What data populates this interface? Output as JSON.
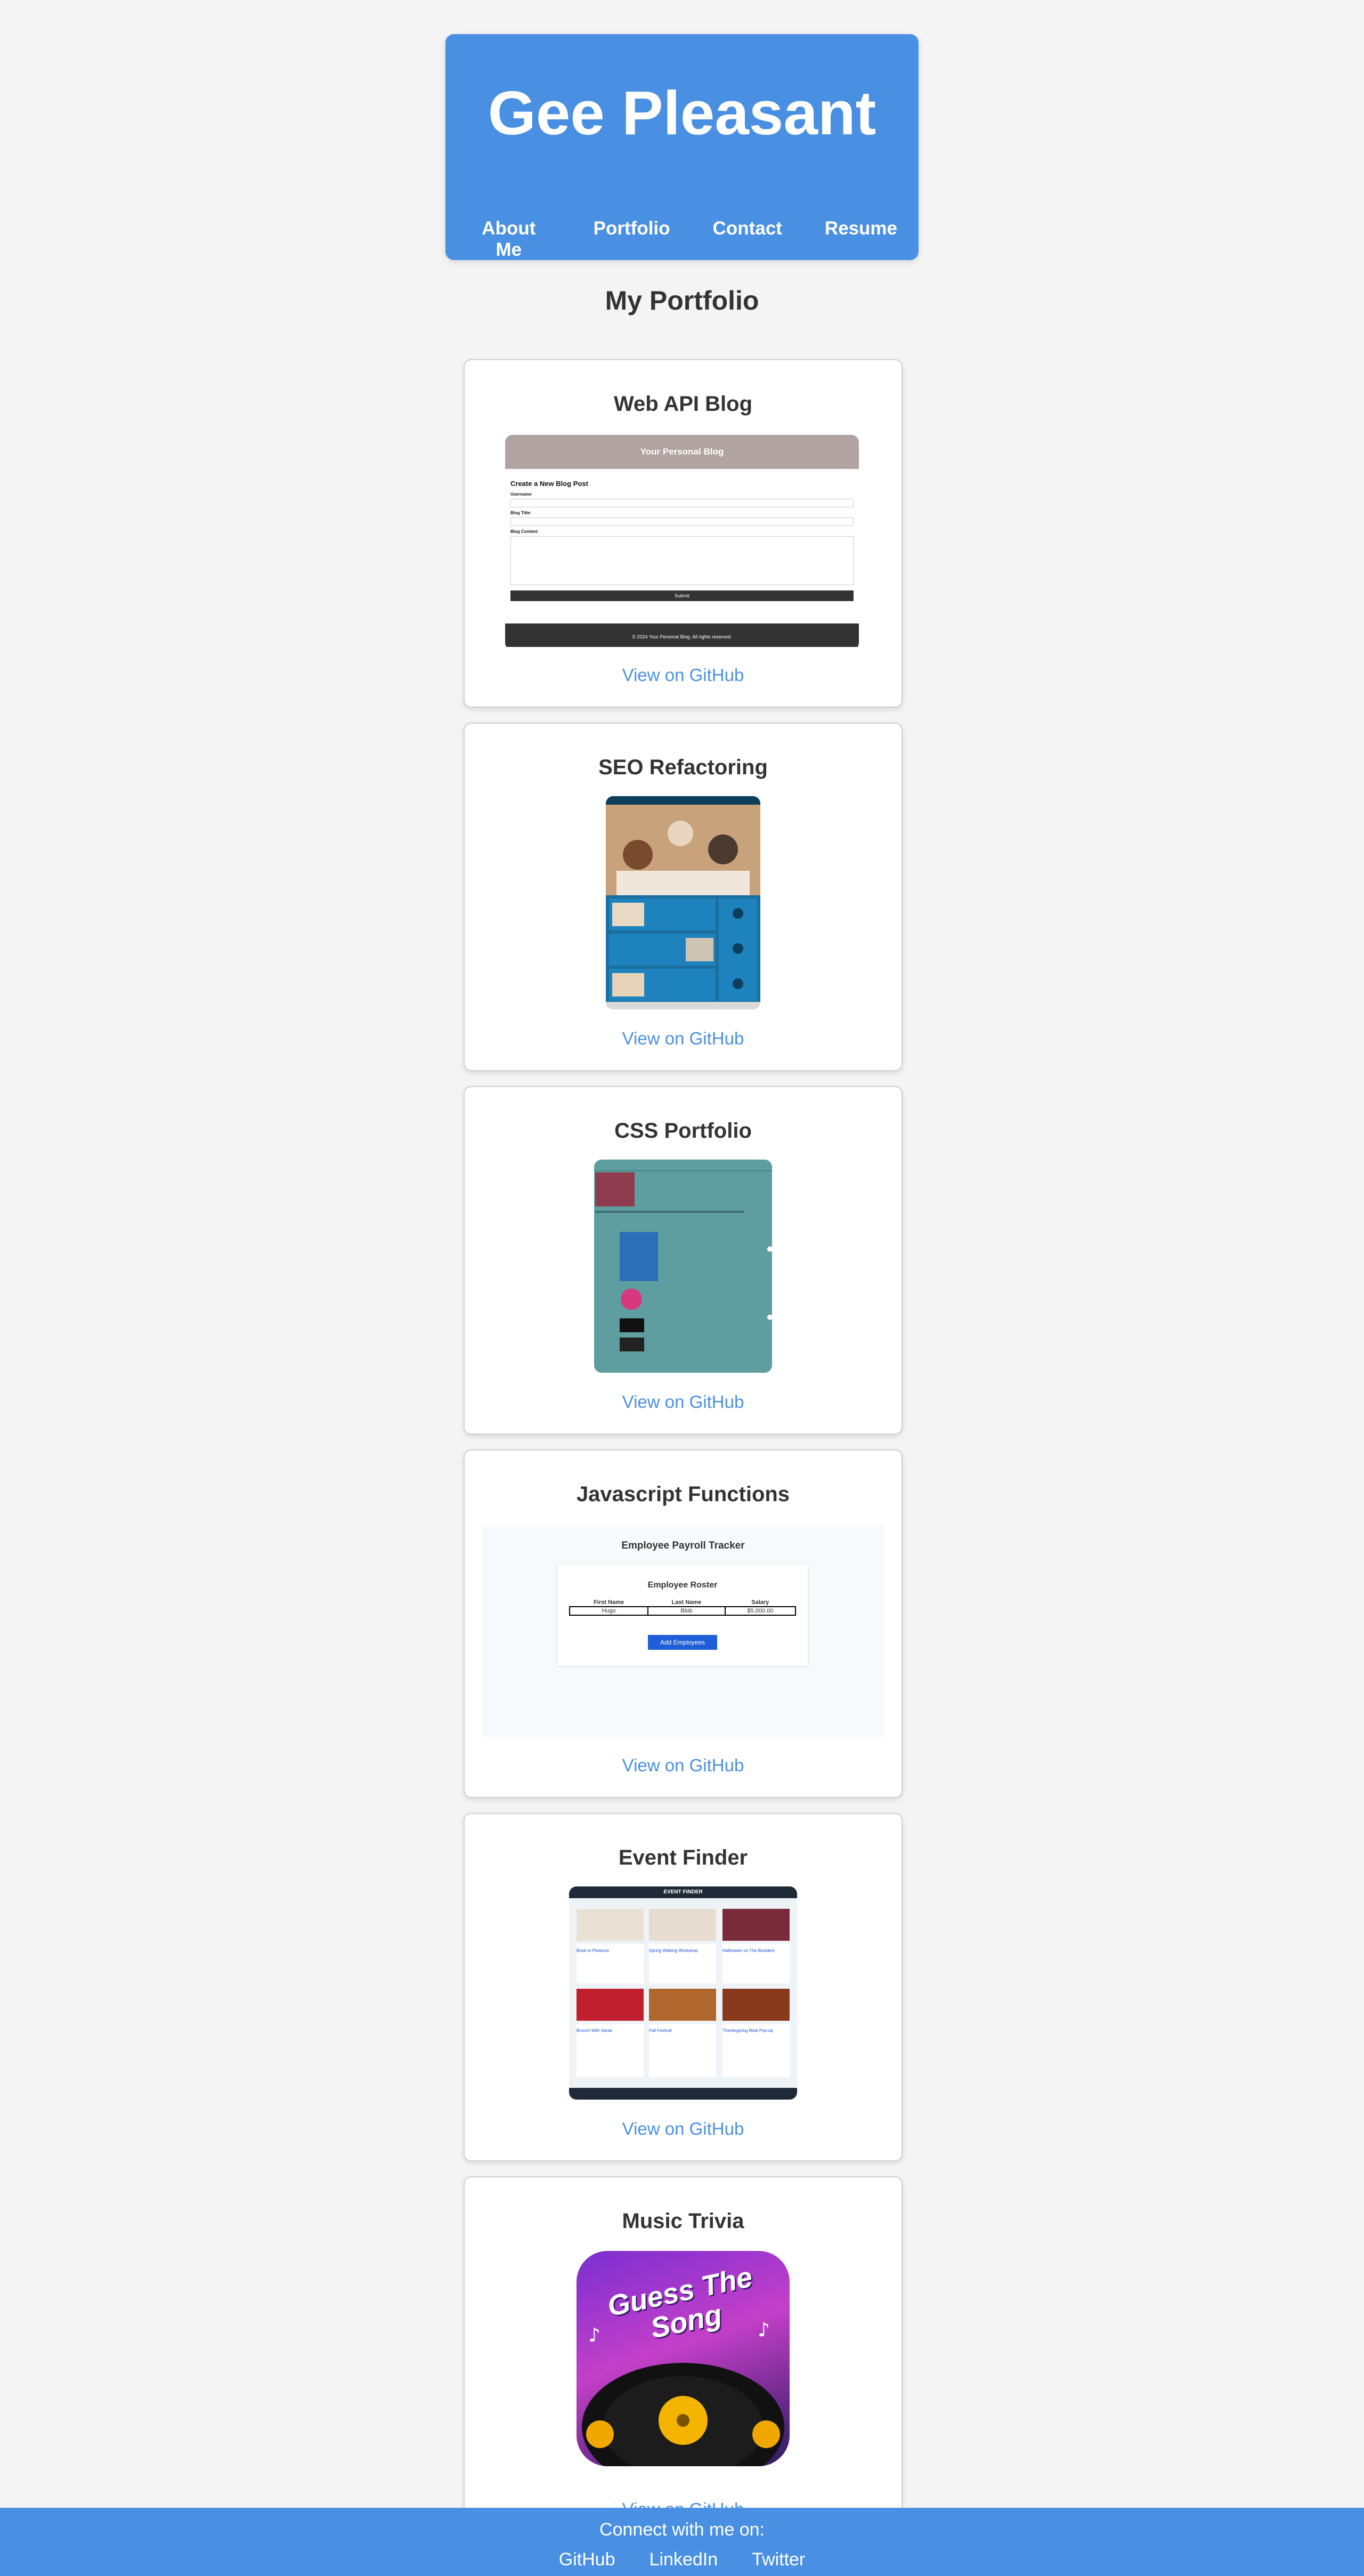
{
  "header": {
    "title": "Gee Pleasant",
    "nav": [
      "About Me",
      "Portfolio",
      "Contact",
      "Resume"
    ]
  },
  "portfolio": {
    "heading": "My Portfolio",
    "link_label": "View on GitHub",
    "projects": [
      {
        "title": "Web API Blog",
        "preview": {
          "banner": "Your Personal Blog",
          "form_title": "Create a New Blog Post",
          "fields": [
            "Username:",
            "Blog Title:",
            "Blog Content:"
          ],
          "submit": "Submit",
          "footer": "© 2024 Your Personal Blog. All rights reserved."
        }
      },
      {
        "title": "SEO Refactoring"
      },
      {
        "title": "CSS Portfolio"
      },
      {
        "title": "Javascript Functions",
        "preview": {
          "app_title": "Employee Payroll Tracker",
          "table_title": "Employee Roster",
          "columns": [
            "First Name",
            "Last Name",
            "Salary"
          ],
          "row": [
            "Hugo",
            "Blob",
            "$5,000.00"
          ],
          "button": "Add Employees"
        }
      },
      {
        "title": "Event Finder",
        "preview": {
          "app_title": "EVENT FINDER",
          "events": [
            "Book to Pleasure",
            "Spring Walking Workshop",
            "Halloween on The Boulders",
            "Brunch With Santa",
            "Fall Festival",
            "Thanksgiving Meal Pop-up"
          ]
        }
      },
      {
        "title": "Music Trivia",
        "preview": {
          "logo_text": "Guess The Song"
        }
      }
    ]
  },
  "footer": {
    "connect": "Connect with me on:",
    "links": [
      "GitHub",
      "LinkedIn",
      "Twitter"
    ]
  },
  "colors": {
    "accent": "#4a90e2",
    "background": "#f4f4f4"
  }
}
